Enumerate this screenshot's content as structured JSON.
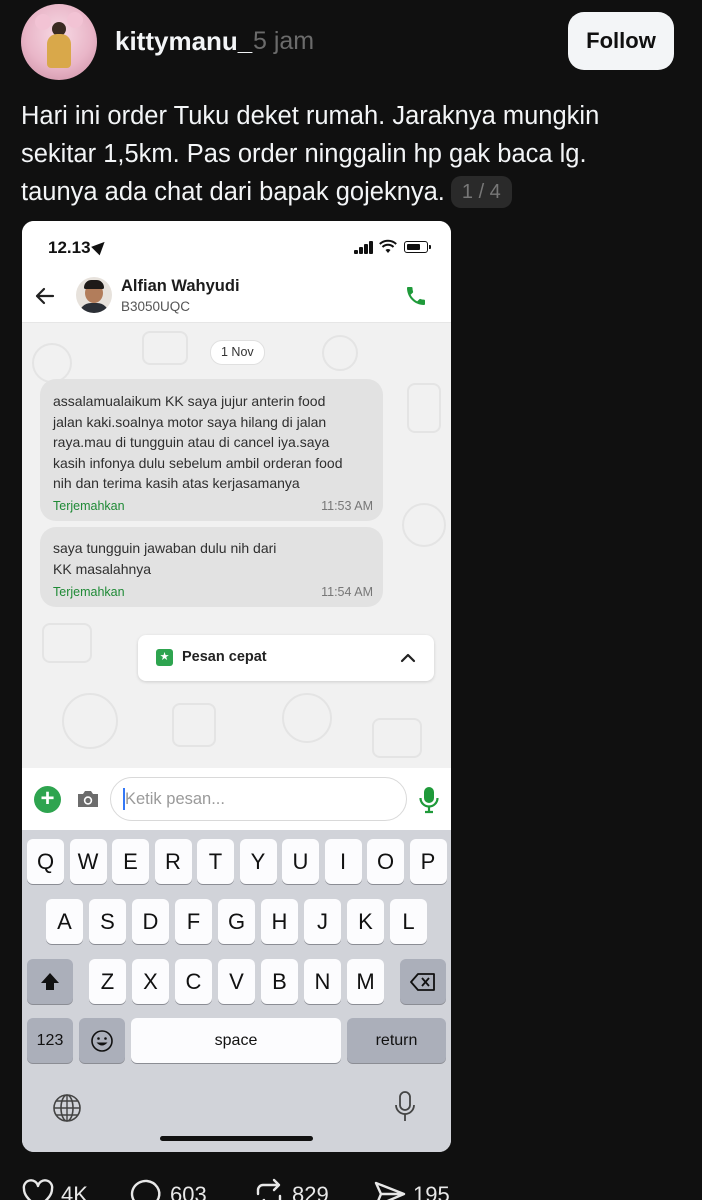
{
  "post": {
    "username": "kittymanu_",
    "time": "5 jam",
    "follow_label": "Follow",
    "text_lines": [
      "Hari ini order Tuku deket rumah. Jaraknya mungkin",
      "sekitar 1,5km. Pas order ninggalin hp gak baca lg.",
      "taunya ada chat dari bapak gojeknya."
    ],
    "image_counter": "1 / 4"
  },
  "phone": {
    "status_time": "12.13",
    "contact_name": "Alfian Wahyudi",
    "contact_plate": "B3050UQC",
    "date_chip": "1 Nov",
    "messages": [
      {
        "lines": [
          "assalamualaikum KK saya jujur anterin food",
          "jalan kaki.soalnya motor saya hilang di jalan",
          "raya.mau di tungguin atau di cancel iya.saya",
          "kasih infonya dulu sebelum ambil orderan food",
          "nih dan terima kasih atas kerjasamanya"
        ],
        "translate_label": "Terjemahkan",
        "time": "11:53 AM"
      },
      {
        "lines": [
          "saya tungguin jawaban dulu nih dari",
          "KK masalahnya"
        ],
        "translate_label": "Terjemahkan",
        "time": "11:54 AM"
      }
    ],
    "quick_reply_label": "Pesan cepat",
    "input_placeholder": "Ketik pesan...",
    "keyboard": {
      "row1": [
        "Q",
        "W",
        "E",
        "R",
        "T",
        "Y",
        "U",
        "I",
        "O",
        "P"
      ],
      "row2": [
        "A",
        "S",
        "D",
        "F",
        "G",
        "H",
        "J",
        "K",
        "L"
      ],
      "row3": [
        "Z",
        "X",
        "C",
        "V",
        "B",
        "N",
        "M"
      ],
      "numbers_label": "123",
      "space_label": "space",
      "return_label": "return"
    }
  },
  "actions": {
    "likes": "4K",
    "comments": "603",
    "reposts": "829",
    "shares": "195"
  },
  "colors": {
    "background": "#101010",
    "accent_green": "#2ea44f",
    "bubble": "#e2e2e2"
  }
}
